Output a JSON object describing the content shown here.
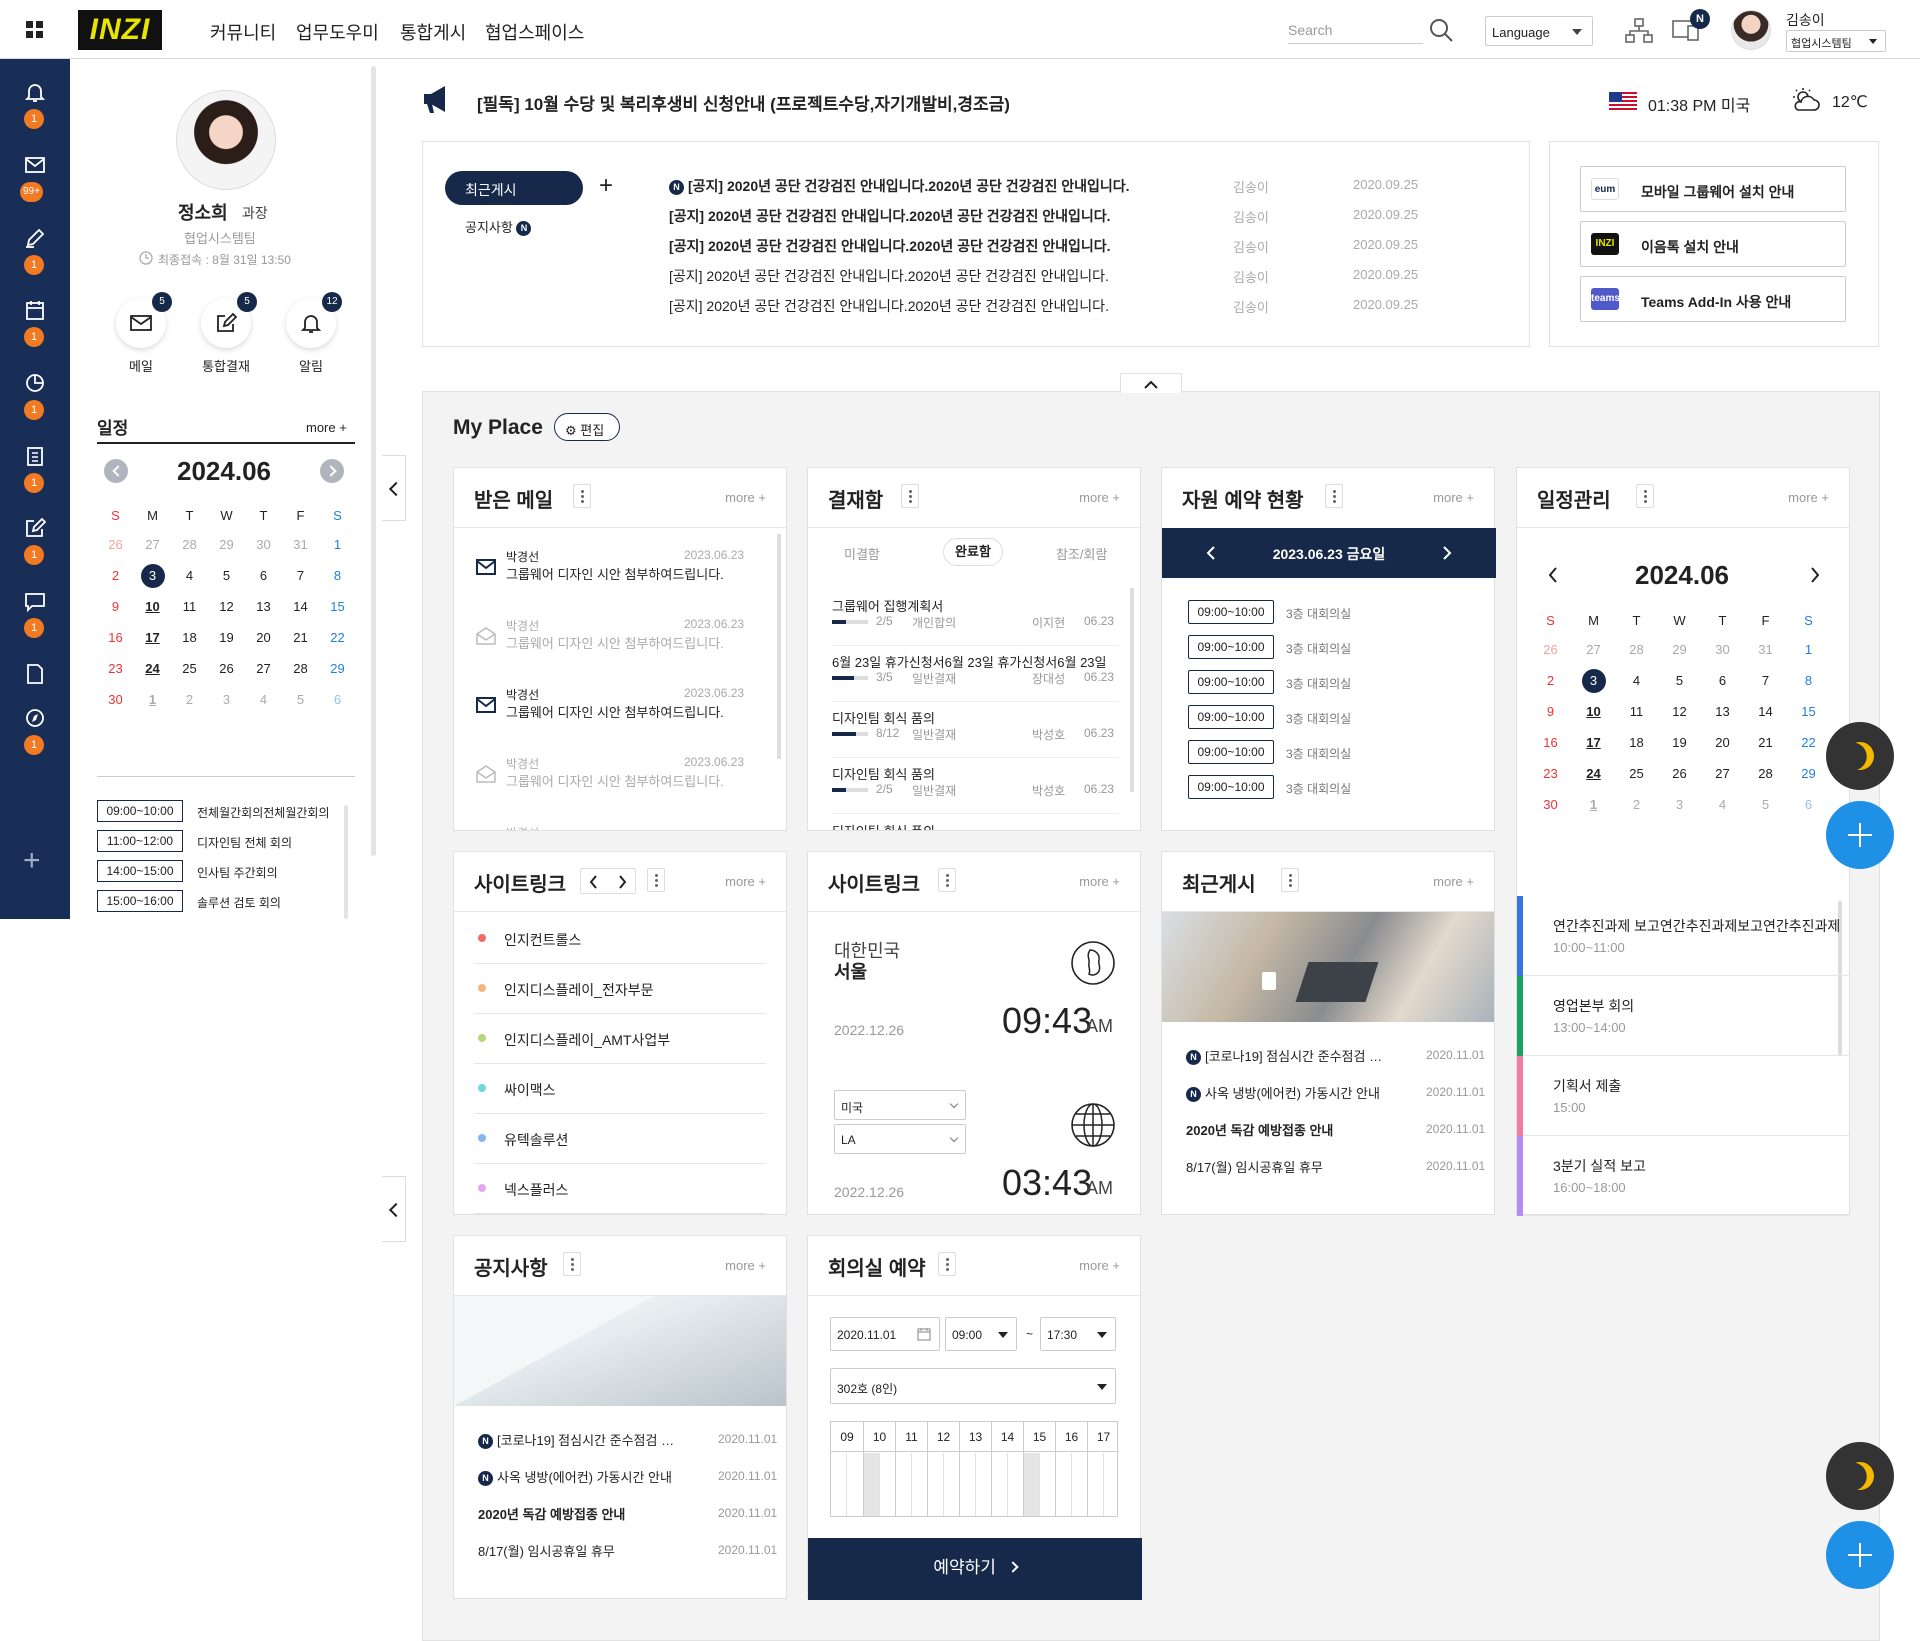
{
  "header": {
    "logo": "INZI",
    "nav": [
      "커뮤니티",
      "업무도우미",
      "통합게시",
      "협업스페이스"
    ],
    "search_placeholder": "Search",
    "language": "Language",
    "pc_badge": "N",
    "user_name": "김송이",
    "user_group": "협업시스템팀"
  },
  "rail": {
    "items": [
      {
        "icon": "bell-icon",
        "badge": "1"
      },
      {
        "icon": "mail-icon",
        "badge": "99+"
      },
      {
        "icon": "pen-icon",
        "badge": "1"
      },
      {
        "icon": "calendar-icon",
        "badge": "1"
      },
      {
        "icon": "clock-icon",
        "badge": "1"
      },
      {
        "icon": "clipboard-icon",
        "badge": "1"
      },
      {
        "icon": "edit-icon",
        "badge": "1"
      },
      {
        "icon": "chat-icon",
        "badge": "1"
      },
      {
        "icon": "document-icon",
        "badge": ""
      },
      {
        "icon": "compass-icon",
        "badge": "1"
      }
    ],
    "add_label": "+"
  },
  "profile": {
    "name": "정소희",
    "rank": "과장",
    "team": "협업시스템팀",
    "last_login": "최종접속 : 8월 31일 13:50",
    "quick": [
      {
        "label": "메일",
        "badge": "5"
      },
      {
        "label": "통합결재",
        "badge": "5"
      },
      {
        "label": "알림",
        "badge": "12"
      }
    ]
  },
  "schedule": {
    "title": "일정",
    "more": "more +",
    "month": "2024.06",
    "weekdays": [
      "S",
      "M",
      "T",
      "W",
      "T",
      "F",
      "S"
    ],
    "weeks": [
      [
        "26",
        "27",
        "28",
        "29",
        "30",
        "31",
        "1"
      ],
      [
        "2",
        "3",
        "4",
        "5",
        "6",
        "7",
        "8"
      ],
      [
        "9",
        "10",
        "11",
        "12",
        "13",
        "14",
        "15"
      ],
      [
        "16",
        "17",
        "18",
        "19",
        "20",
        "21",
        "22"
      ],
      [
        "23",
        "24",
        "25",
        "26",
        "27",
        "28",
        "29"
      ],
      [
        "30",
        "1",
        "2",
        "3",
        "4",
        "5",
        "6"
      ]
    ],
    "events": [
      {
        "time": "09:00~10:00",
        "title": "전체월간회의전체월간회의"
      },
      {
        "time": "11:00~12:00",
        "title": "디자인팀 전체 회의"
      },
      {
        "time": "14:00~15:00",
        "title": "인사팀 주간회의"
      },
      {
        "time": "15:00~16:00",
        "title": "솔루션 검토 회의"
      }
    ]
  },
  "notice_banner": {
    "text": "[필독] 10월 수당 및 복리후생비 신청안내 (프로젝트수당,자기개발비,경조금)",
    "time": "01:38 PM 미국",
    "weather": "12℃"
  },
  "board": {
    "tab_active": "최근게시",
    "tab_add": "+",
    "tab_sub": "공지사항",
    "rows": [
      {
        "new": true,
        "title": "[공지] 2020년 공단 건강검진 안내입니다.2020년 공단 건강검진 안내입니다.",
        "author": "김송이",
        "date": "2020.09.25",
        "bold": true
      },
      {
        "new": false,
        "title": "[공지] 2020년 공단 건강검진 안내입니다.2020년 공단 건강검진 안내입니다.",
        "author": "김송이",
        "date": "2020.09.25",
        "bold": true
      },
      {
        "new": false,
        "title": "[공지] 2020년 공단 건강검진 안내입니다.2020년 공단 건강검진 안내입니다.",
        "author": "김송이",
        "date": "2020.09.25",
        "bold": true
      },
      {
        "new": false,
        "title": "[공지] 2020년 공단 건강검진 안내입니다.2020년 공단 건강검진 안내입니다.",
        "author": "김송이",
        "date": "2020.09.25",
        "bold": false
      },
      {
        "new": false,
        "title": "[공지] 2020년 공단 건강검진 안내입니다.2020년 공단 건강검진 안내입니다.",
        "author": "김송이",
        "date": "2020.09.25",
        "bold": false
      }
    ]
  },
  "guides": [
    {
      "logo": "eum",
      "label": "모바일 그룹웨어 설치 안내"
    },
    {
      "logo": "INZI",
      "label": "이음톡 설치 안내"
    },
    {
      "logo": "teams",
      "label": "Teams Add-In 사용 안내"
    }
  ],
  "myplace": {
    "title": "My Place",
    "edit": "편집"
  },
  "mail_card": {
    "title": "받은 메일",
    "more": "more +",
    "items": [
      {
        "from": "박경선",
        "subject": "그룹웨어 디자인 시안 첨부하여드립니다.",
        "date": "2023.06.23",
        "read": false
      },
      {
        "from": "박경선",
        "subject": "그룹웨어 디자인 시안 첨부하여드립니다.",
        "date": "2023.06.23",
        "read": true
      },
      {
        "from": "박경선",
        "subject": "그룹웨어 디자인 시안 첨부하여드립니다.",
        "date": "2023.06.23",
        "read": false
      },
      {
        "from": "박경선",
        "subject": "그룹웨어 디자인 시안 첨부하여드립니다.",
        "date": "2023.06.23",
        "read": true
      }
    ],
    "cut": "박경선"
  },
  "approval_card": {
    "title": "결재함",
    "more": "more +",
    "tabs": [
      "미결함",
      "완료함",
      "참조/회람"
    ],
    "items": [
      {
        "title": "그룹웨어 집행계획서",
        "progress": "2/5",
        "type": "개인합의",
        "author": "이지현",
        "date": "06.23"
      },
      {
        "title": "6월 23일 휴가신청서6월 23일 휴가신청서6월 23일",
        "progress": "3/5",
        "type": "일반결재",
        "author": "장대성",
        "date": "06.23"
      },
      {
        "title": "디자인팀 회식 품의",
        "progress": "8/12",
        "type": "일반결재",
        "author": "박성호",
        "date": "06.23"
      },
      {
        "title": "디자인팀 회식 품의",
        "progress": "2/5",
        "type": "일반결재",
        "author": "박성호",
        "date": "06.23"
      }
    ],
    "cut": "디자인팀 회식 품의"
  },
  "resource_card": {
    "title": "자원 예약 현황",
    "more": "more +",
    "date": "2023.06.23 금요일",
    "items": [
      {
        "time": "09:00~10:00",
        "room": "3층 대회의실"
      },
      {
        "time": "09:00~10:00",
        "room": "3층 대회의실"
      },
      {
        "time": "09:00~10:00",
        "room": "3층 대회의실"
      },
      {
        "time": "09:00~10:00",
        "room": "3층 대회의실"
      },
      {
        "time": "09:00~10:00",
        "room": "3층 대회의실"
      },
      {
        "time": "09:00~10:00",
        "room": "3층 대회의실"
      }
    ]
  },
  "calendar_card": {
    "title": "일정관리",
    "more": "more +",
    "month": "2024.06",
    "events": [
      {
        "title": "연간추진과제 보고연간추진과제보고연간추진과제",
        "time": "10:00~11:00",
        "color": "#3a74e0"
      },
      {
        "title": "영업본부 회의",
        "time": "13:00~14:00",
        "color": "#1aa260"
      },
      {
        "title": "기획서 제출",
        "time": "15:00",
        "color": "#f07ba0"
      },
      {
        "title": "3분기 실적 보고",
        "time": "16:00~18:00",
        "color": "#b38cf0"
      }
    ]
  },
  "sitelink1": {
    "title": "사이트링크",
    "more": "more +",
    "items": [
      {
        "label": "인지컨트롤스",
        "color": "#f06a6a"
      },
      {
        "label": "인지디스플레이_전자부문",
        "color": "#f5b57a"
      },
      {
        "label": "인지디스플레이_AMT사업부",
        "color": "#b6d67b"
      },
      {
        "label": "싸이맥스",
        "color": "#6fd6dc"
      },
      {
        "label": "유텍솔루션",
        "color": "#87b6ef"
      },
      {
        "label": "넥스플러스",
        "color": "#e4a7ef"
      }
    ]
  },
  "sitelink2": {
    "title": "사이트링크",
    "more": "more +",
    "country": "대한민국",
    "city": "서울",
    "date1": "2022.12.26",
    "time1": "09:43",
    "ampm1": "AM",
    "select_country": "미국",
    "select_city": "LA",
    "date2": "2022.12.26",
    "time2": "03:43",
    "ampm2": "AM"
  },
  "recent_card": {
    "title": "최근게시",
    "more": "more +",
    "items": [
      {
        "new": true,
        "title": "[코로나19] 점심시간 준수점검 안내",
        "date": "2020.11.01",
        "bold": false
      },
      {
        "new": true,
        "title": "사옥 냉방(에어컨) 가동시간 안내",
        "date": "2020.11.01",
        "bold": false
      },
      {
        "new": false,
        "title": "2020년 독감 예방접종 안내",
        "date": "2020.11.01",
        "bold": true
      },
      {
        "new": false,
        "title": "8/17(월) 임시공휴일 휴무",
        "date": "2020.11.01",
        "bold": false
      }
    ]
  },
  "notice_card": {
    "title": "공지사항",
    "more": "more +",
    "items": [
      {
        "new": true,
        "title": "[코로나19] 점심시간 준수점검 안내",
        "date": "2020.11.01",
        "bold": false
      },
      {
        "new": true,
        "title": "사옥 냉방(에어컨) 가동시간 안내",
        "date": "2020.11.01",
        "bold": false
      },
      {
        "new": false,
        "title": "2020년 독감 예방접종 안내",
        "date": "2020.11.01",
        "bold": true
      },
      {
        "new": false,
        "title": "8/17(월) 임시공휴일 휴무",
        "date": "2020.11.01",
        "bold": false
      }
    ]
  },
  "meeting_card": {
    "title": "회의실 예약",
    "more": "more +",
    "date": "2020.11.01",
    "start": "09:00",
    "tilde": "~",
    "end": "17:30",
    "room": "302호 (8인)",
    "hours": [
      "09",
      "10",
      "11",
      "12",
      "13",
      "14",
      "15",
      "16",
      "17"
    ],
    "book": "예약하기"
  }
}
